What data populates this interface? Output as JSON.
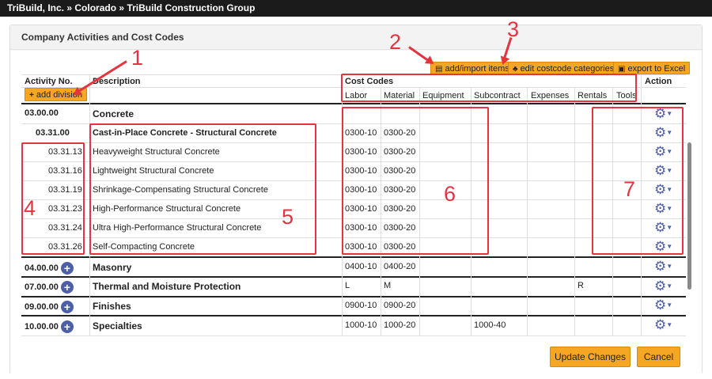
{
  "breadcrumb": [
    "TriBuild, Inc.",
    "Colorado",
    "TriBuild Construction Group"
  ],
  "breadcrumb_sep": "»",
  "panel_title": "Company Activities and Cost Codes",
  "toolbar": {
    "add_import": "add/import items",
    "edit_categories": "edit costcode categories",
    "export": "export to Excel",
    "add_division": "add division"
  },
  "headers": {
    "activity": "Activity No.",
    "description": "Description",
    "cost_codes": "Cost Codes",
    "action": "Action",
    "subcols": [
      "Labor",
      "Material",
      "Equipment",
      "Subcontract",
      "Expenses",
      "Rentals",
      "Tools"
    ]
  },
  "rows": [
    {
      "no": "03.00.00",
      "desc": "Concrete",
      "labor": "",
      "material": "",
      "equipment": "",
      "subcontract": "",
      "expenses": "",
      "rentals": "",
      "tools": ""
    },
    {
      "no": "03.31.00",
      "desc": "Cast-in-Place Concrete - Structural Concrete",
      "labor": "0300-10",
      "material": "0300-20",
      "equipment": "",
      "subcontract": "",
      "expenses": "",
      "rentals": "",
      "tools": ""
    },
    {
      "no": "03.31.13",
      "desc": "Heavyweight Structural Concrete",
      "labor": "0300-10",
      "material": "0300-20",
      "equipment": "",
      "subcontract": "",
      "expenses": "",
      "rentals": "",
      "tools": ""
    },
    {
      "no": "03.31.16",
      "desc": "Lightweight Structural Concrete",
      "labor": "0300-10",
      "material": "0300-20",
      "equipment": "",
      "subcontract": "",
      "expenses": "",
      "rentals": "",
      "tools": ""
    },
    {
      "no": "03.31.19",
      "desc": "Shrinkage-Compensating Structural Concrete",
      "labor": "0300-10",
      "material": "0300-20",
      "equipment": "",
      "subcontract": "",
      "expenses": "",
      "rentals": "",
      "tools": ""
    },
    {
      "no": "03.31.23",
      "desc": "High-Performance Structural Concrete",
      "labor": "0300-10",
      "material": "0300-20",
      "equipment": "",
      "subcontract": "",
      "expenses": "",
      "rentals": "",
      "tools": ""
    },
    {
      "no": "03.31.24",
      "desc": "Ultra High-Performance Structural Concrete",
      "labor": "0300-10",
      "material": "0300-20",
      "equipment": "",
      "subcontract": "",
      "expenses": "",
      "rentals": "",
      "tools": ""
    },
    {
      "no": "03.31.26",
      "desc": "Self-Compacting Concrete",
      "labor": "0300-10",
      "material": "0300-20",
      "equipment": "",
      "subcontract": "",
      "expenses": "",
      "rentals": "",
      "tools": ""
    },
    {
      "no": "04.00.00",
      "desc": "Masonry",
      "labor": "0400-10",
      "material": "0400-20",
      "equipment": "",
      "subcontract": "",
      "expenses": "",
      "rentals": "",
      "tools": ""
    },
    {
      "no": "07.00.00",
      "desc": "Thermal and Moisture Protection",
      "labor": "L",
      "material": "M",
      "equipment": "",
      "subcontract": "",
      "expenses": "",
      "rentals": "R",
      "tools": ""
    },
    {
      "no": "09.00.00",
      "desc": "Finishes",
      "labor": "0900-10",
      "material": "0900-20",
      "equipment": "",
      "subcontract": "",
      "expenses": "",
      "rentals": "",
      "tools": ""
    },
    {
      "no": "10.00.00",
      "desc": "Specialties",
      "labor": "1000-10",
      "material": "1000-20",
      "equipment": "",
      "subcontract": "1000-40",
      "expenses": "",
      "rentals": "",
      "tools": ""
    }
  ],
  "annotations": [
    "1",
    "2",
    "3",
    "4",
    "5",
    "6",
    "7"
  ],
  "footer": {
    "update": "Update Changes",
    "cancel": "Cancel"
  },
  "colors": {
    "accent": "#f5a623",
    "annotation": "#e53340",
    "icon": "#4c5fa8",
    "topbar": "#1b1b1b"
  }
}
